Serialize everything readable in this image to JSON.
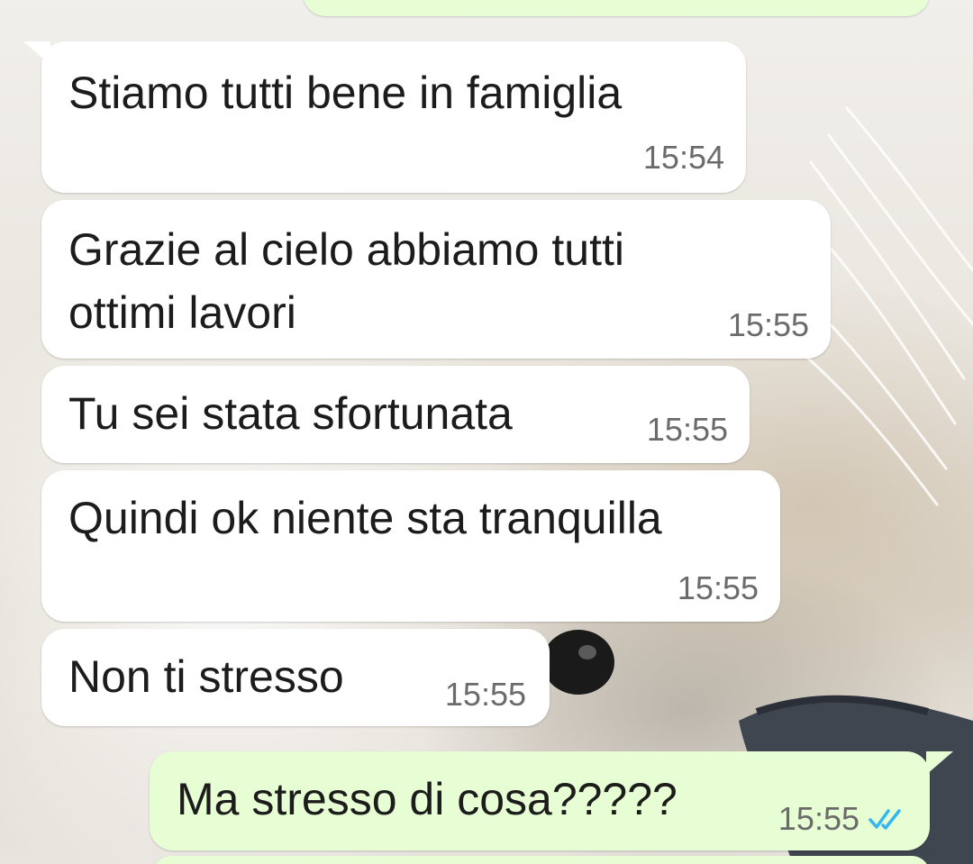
{
  "conversation": {
    "messages": [
      {
        "direction": "incoming",
        "text": [
          "Stiamo tutti bene in famiglia"
        ],
        "time": "15:54"
      },
      {
        "direction": "incoming",
        "text": [
          "Grazie al cielo abbiamo tutti",
          "ottimi lavori"
        ],
        "time": "15:55"
      },
      {
        "direction": "incoming",
        "text": [
          "Tu sei stata sfortunata"
        ],
        "time": "15:55"
      },
      {
        "direction": "incoming",
        "text": [
          "Quindi ok niente sta tranquilla"
        ],
        "time": "15:55"
      },
      {
        "direction": "incoming",
        "text": [
          "Non ti stresso"
        ],
        "time": "15:55"
      },
      {
        "direction": "outgoing",
        "text": [
          "Ma stresso di cosa?????"
        ],
        "time": "15:55",
        "status": "read"
      }
    ]
  },
  "icons": {
    "read_receipt": "double-check-icon"
  },
  "colors": {
    "incoming_bubble": "#ffffff",
    "outgoing_bubble": "#e7fdd3",
    "time_text": "#6b6b6b",
    "read_check": "#34b7f1"
  }
}
